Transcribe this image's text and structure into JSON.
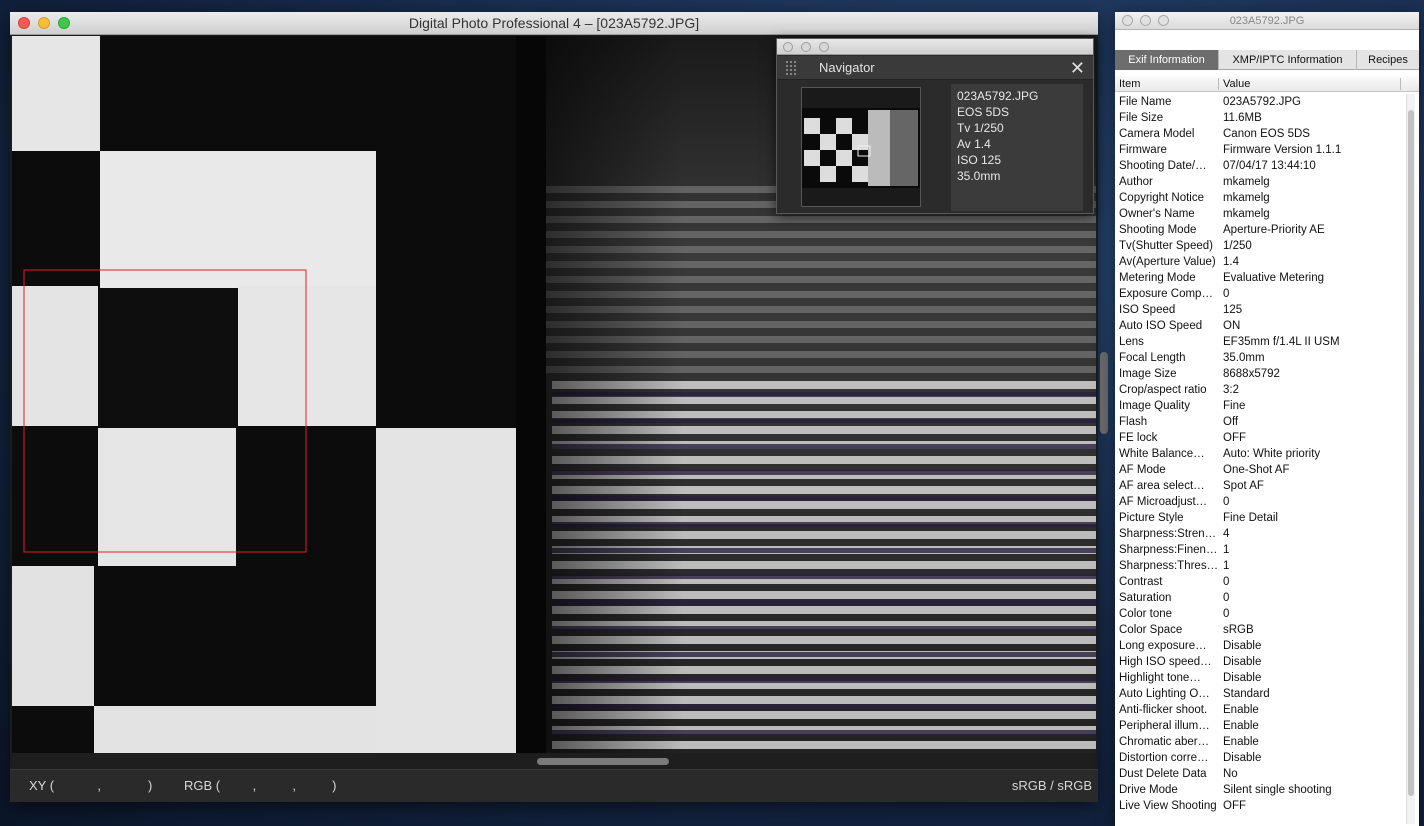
{
  "main_window": {
    "title": "Digital Photo Professional 4 – [023A5792.JPG]"
  },
  "statusbar": {
    "xy": "XY (            ,             )",
    "rgb": "RGB (         ,          ,          )",
    "color_space": "sRGB / sRGB"
  },
  "navigator": {
    "title": "Navigator",
    "close_glyph": "✕",
    "info": [
      "023A5792.JPG",
      "EOS 5DS",
      "Tv 1/250",
      "Av 1.4",
      "ISO 125",
      "35.0mm"
    ]
  },
  "info_window": {
    "title": "023A5792.JPG",
    "tabs": [
      "Exif Information",
      "XMP/IPTC Information",
      "Recipes"
    ],
    "active_tab": 0,
    "columns": [
      "Item",
      "Value"
    ],
    "rows": [
      [
        "File Name",
        "023A5792.JPG"
      ],
      [
        "File Size",
        "11.6MB"
      ],
      [
        "Camera Model",
        "Canon EOS 5DS"
      ],
      [
        "Firmware",
        "Firmware Version 1.1.1"
      ],
      [
        "Shooting Date/…",
        "07/04/17 13:44:10"
      ],
      [
        "Author",
        "mkamelg"
      ],
      [
        "Copyright Notice",
        "mkamelg"
      ],
      [
        "Owner's Name",
        "mkamelg"
      ],
      [
        "Shooting Mode",
        "Aperture-Priority AE"
      ],
      [
        "Tv(Shutter Speed)",
        "1/250"
      ],
      [
        "Av(Aperture Value)",
        "1.4"
      ],
      [
        "Metering Mode",
        "Evaluative Metering"
      ],
      [
        "Exposure Comp…",
        "0"
      ],
      [
        "ISO Speed",
        "125"
      ],
      [
        "Auto ISO Speed",
        "ON"
      ],
      [
        "Lens",
        "EF35mm f/1.4L II USM"
      ],
      [
        "Focal Length",
        "35.0mm"
      ],
      [
        "Image Size",
        "8688x5792"
      ],
      [
        "Crop/aspect ratio",
        "3:2"
      ],
      [
        "Image Quality",
        "Fine"
      ],
      [
        "Flash",
        "Off"
      ],
      [
        "FE lock",
        "OFF"
      ],
      [
        "White Balance…",
        "Auto: White priority"
      ],
      [
        "AF Mode",
        "One-Shot AF"
      ],
      [
        "AF area select…",
        "Spot AF"
      ],
      [
        "AF Microadjust…",
        "0"
      ],
      [
        "Picture Style",
        "Fine Detail"
      ],
      [
        "Sharpness:Stren…",
        "4"
      ],
      [
        "Sharpness:Finen…",
        "1"
      ],
      [
        "Sharpness:Thres…",
        "1"
      ],
      [
        "Contrast",
        "0"
      ],
      [
        "Saturation",
        "0"
      ],
      [
        "Color tone",
        "0"
      ],
      [
        "Color Space",
        "sRGB"
      ],
      [
        "Long exposure…",
        "Disable"
      ],
      [
        "High ISO speed…",
        "Disable"
      ],
      [
        "Highlight tone…",
        "Disable"
      ],
      [
        "Auto Lighting O…",
        "Standard"
      ],
      [
        "Anti-flicker shoot.",
        "Enable"
      ],
      [
        "Peripheral illum…",
        "Enable"
      ],
      [
        "Chromatic aber…",
        "Enable"
      ],
      [
        "Distortion corre…",
        "Disable"
      ],
      [
        "Dust Delete Data",
        "No"
      ],
      [
        "Drive Mode",
        "Silent single shooting"
      ],
      [
        "Live View Shooting",
        "OFF"
      ]
    ]
  }
}
